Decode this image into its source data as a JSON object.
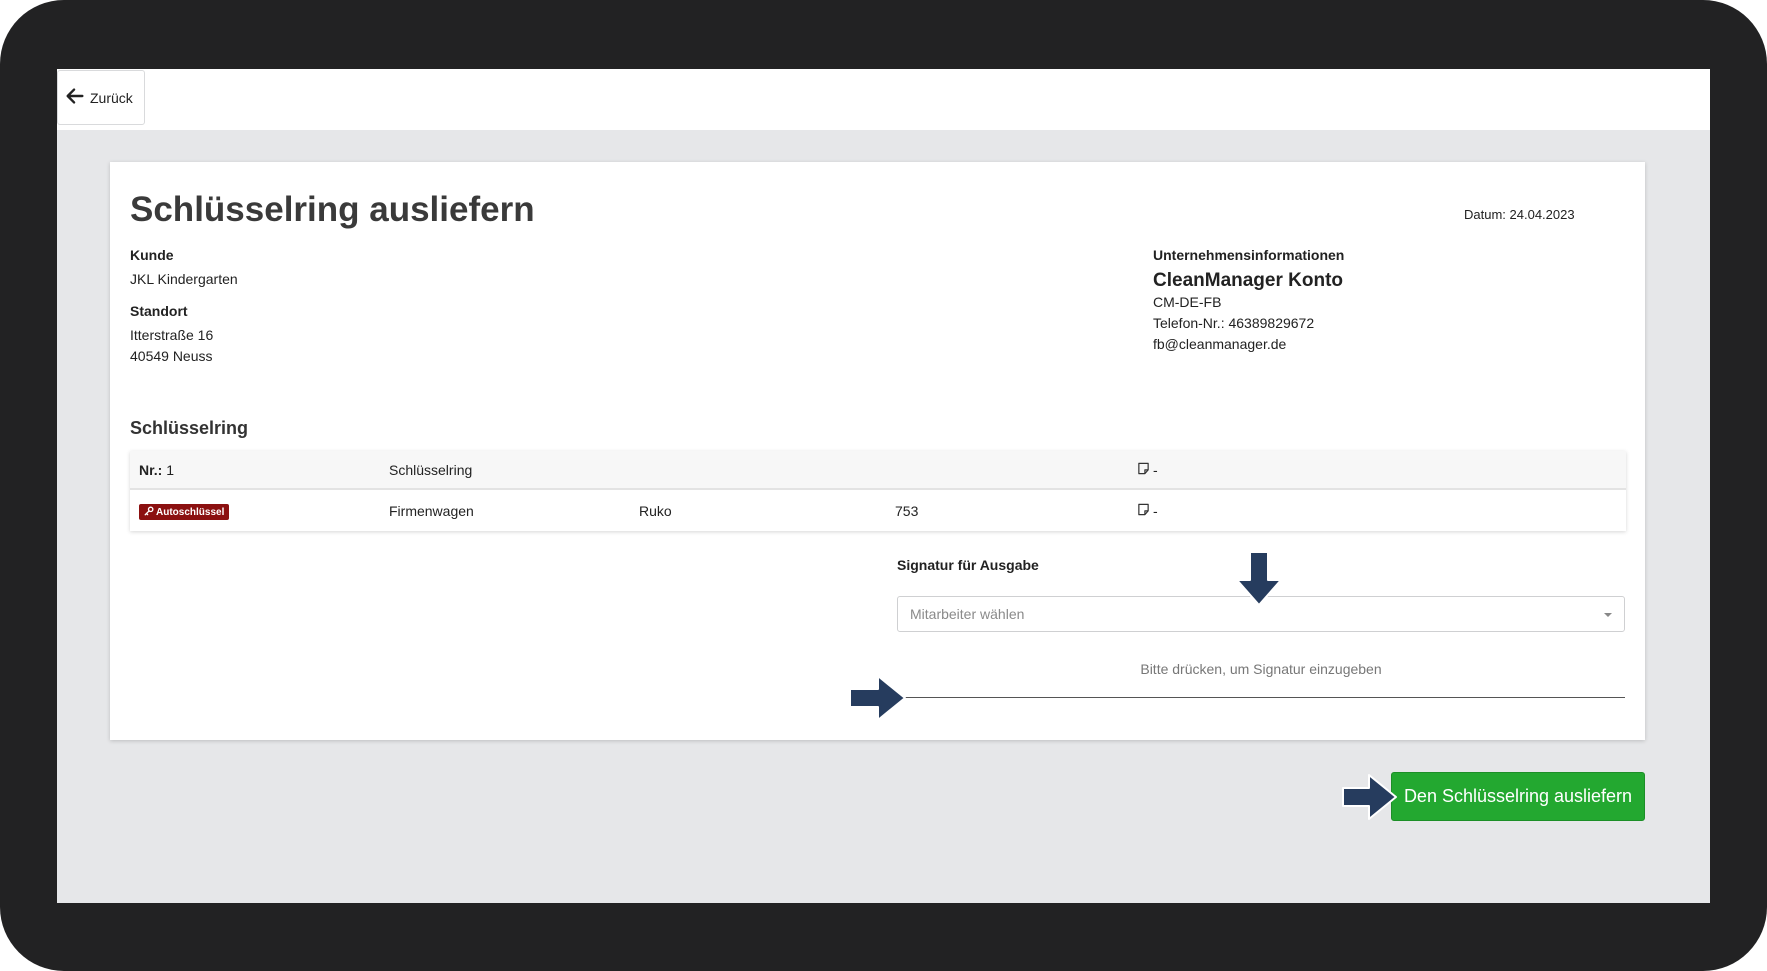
{
  "toolbar": {
    "back_label": "Zurück"
  },
  "page": {
    "title": "Schlüsselring ausliefern",
    "date": "Datum: 24.04.2023"
  },
  "customer": {
    "label": "Kunde",
    "name": "JKL Kindergarten",
    "location_label": "Standort",
    "street": "Itterstraße 16",
    "city": "40549 Neuss"
  },
  "company": {
    "label": "Unternehmensinformationen",
    "name": "CleanManager Konto",
    "code": "CM-DE-FB",
    "phone": "Telefon-Nr.: 46389829672",
    "email": "fb@cleanmanager.de"
  },
  "keyring": {
    "section_title": "Schlüsselring",
    "header": {
      "nr_label": "Nr.:",
      "nr_value": "1",
      "name": "Schlüsselring",
      "note": "-"
    },
    "items": [
      {
        "badge": "Autoschlüssel",
        "name": "Firmenwagen",
        "brand": "Ruko",
        "number": "753",
        "note": "-"
      }
    ]
  },
  "signature": {
    "label": "Signatur für Ausgabe",
    "select_placeholder": "Mitarbeiter wählen",
    "pad_hint": "Bitte drücken, um Signatur einzugeben"
  },
  "actions": {
    "deliver_label": "Den Schlüsselring ausliefern"
  },
  "colors": {
    "badge": "#8b1010",
    "primary_button": "#23a830",
    "annotation_arrow": "#263c5e",
    "frame": "#222223"
  },
  "icons": [
    "arrow-left-icon",
    "key-icon",
    "note-icon",
    "caret-down-icon",
    "arrow-down-annotation",
    "arrow-right-annotation"
  ]
}
